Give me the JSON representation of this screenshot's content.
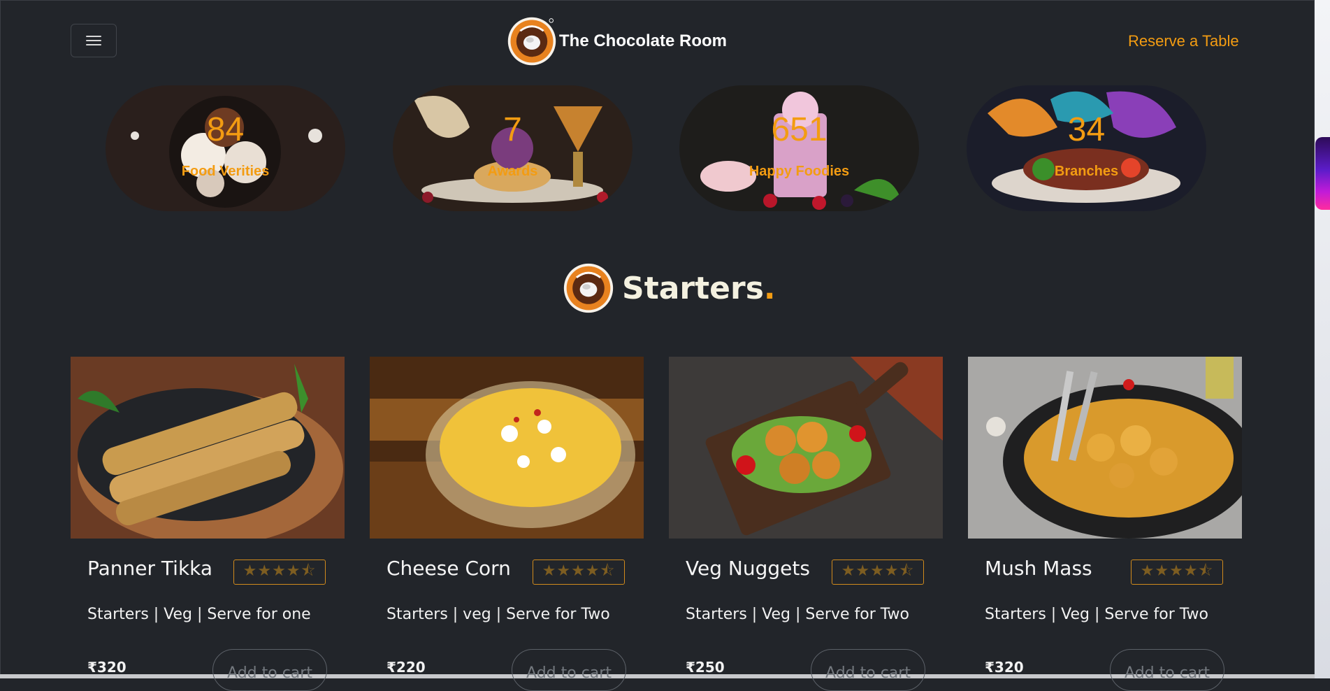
{
  "header": {
    "brand_name": "The Chocolate Room",
    "reserve_label": "Reserve a Table"
  },
  "stats": [
    {
      "number": "84",
      "label": "Food Verities"
    },
    {
      "number": "7",
      "label": "Awards"
    },
    {
      "number": "651",
      "label": "Happy Foodies"
    },
    {
      "number": "34",
      "label": "Branches"
    }
  ],
  "section": {
    "title": "Starters",
    "title_dot": "."
  },
  "cards": [
    {
      "name": "Panner Tikka",
      "desc": "Starters | Veg | Serve for one",
      "price": "₹320",
      "rating_stars": "★★★★⯪",
      "rating_value": 4.5,
      "cart_label": "Add to cart"
    },
    {
      "name": "Cheese Corn",
      "desc": "Starters | veg | Serve for Two",
      "price": "₹220",
      "rating_stars": "★★★★⯪",
      "rating_value": 4.5,
      "cart_label": "Add to cart"
    },
    {
      "name": "Veg Nuggets",
      "desc": "Starters | Veg | Serve for Two",
      "price": "₹250",
      "rating_stars": "★★★★⯪",
      "rating_value": 4.5,
      "cart_label": "Add to cart"
    },
    {
      "name": "Mush Mass",
      "desc": "Starters | Veg | Serve for Two",
      "price": "₹320",
      "rating_stars": "★★★★⯪",
      "rating_value": 4.5,
      "cart_label": "Add to cart"
    }
  ],
  "colors": {
    "accent": "#f39c12",
    "background": "#22252a",
    "text": "#f2f2f2"
  },
  "icons": [
    "hamburger-icon",
    "chocolate-room-logo-icon"
  ]
}
